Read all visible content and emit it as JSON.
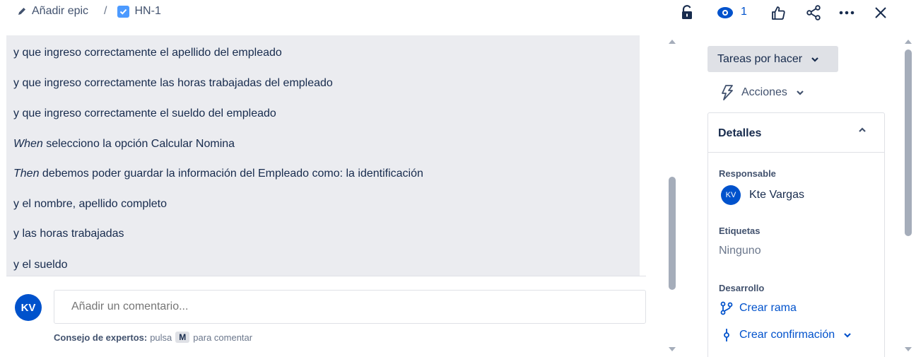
{
  "header": {
    "add_epic_label": "Añadir epic",
    "separator": "/",
    "issue_key": "HN-1",
    "watch_count": "1"
  },
  "description": {
    "lines": [
      {
        "prefix": "",
        "text": "y que ingreso correctamente el apellido del empleado"
      },
      {
        "prefix": "",
        "text": "y que ingreso correctamente las horas trabajadas del empleado"
      },
      {
        "prefix": "",
        "text": "y que ingreso correctamente el sueldo del empleado"
      },
      {
        "prefix": "When",
        "text": " selecciono la opción Calcular Nomina"
      },
      {
        "prefix": "Then",
        "text": " debemos poder guardar la información del Empleado como: la identificación"
      },
      {
        "prefix": "",
        "text": "y el nombre, apellido completo"
      },
      {
        "prefix": "",
        "text": "y las horas trabajadas"
      },
      {
        "prefix": "",
        "text": "y el sueldo"
      }
    ]
  },
  "comment": {
    "avatar_initials": "KV",
    "placeholder": "Añadir un comentario...",
    "tip_bold": "Consejo de expertos:",
    "tip_pre": "pulsa",
    "tip_key": "M",
    "tip_post": "para comentar"
  },
  "sidebar": {
    "status_label": "Tareas por hacer",
    "actions_label": "Acciones",
    "details_title": "Detalles",
    "assignee_label": "Responsable",
    "assignee_initials": "KV",
    "assignee_name": "Kte Vargas",
    "labels_label": "Etiquetas",
    "labels_value": "Ninguno",
    "development_label": "Desarrollo",
    "create_branch": "Crear rama",
    "create_commit": "Crear confirmación"
  },
  "colors": {
    "accent": "#0052cc",
    "description_bg": "#ebecf0",
    "status_bg": "#dfe1e6"
  },
  "icons": [
    "pencil-icon",
    "checkbox-icon",
    "unlock-icon",
    "eye-icon",
    "thumbs-up-icon",
    "share-icon",
    "more-icon",
    "close-icon",
    "lightning-icon",
    "chevron-down-icon",
    "chevron-up-icon",
    "branch-icon",
    "commit-icon"
  ]
}
